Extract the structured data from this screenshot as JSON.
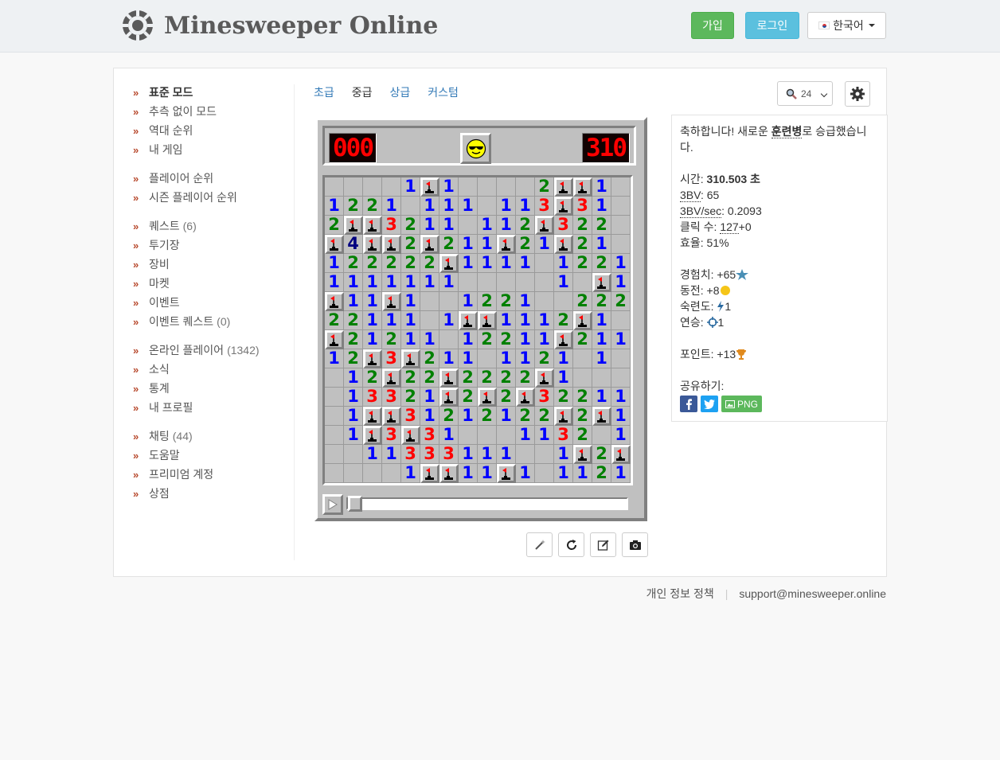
{
  "header": {
    "site_title": "Minesweeper Online",
    "join_label": "가입",
    "login_label": "로그인",
    "language_label": "한국어"
  },
  "sidebar": {
    "groups": [
      [
        {
          "label": "표준 모드",
          "active": true
        },
        {
          "label": "추측 없이 모드"
        },
        {
          "label": "역대 순위"
        },
        {
          "label": "내 게임"
        }
      ],
      [
        {
          "label": "플레이어 순위"
        },
        {
          "label": "시즌 플레이어 순위"
        }
      ],
      [
        {
          "label": "퀘스트",
          "count": "(6)"
        },
        {
          "label": "투기장"
        },
        {
          "label": "장비"
        },
        {
          "label": "마켓"
        },
        {
          "label": "이벤트"
        },
        {
          "label": "이벤트 퀘스트",
          "count": "(0)"
        }
      ],
      [
        {
          "label": "온라인 플레이어",
          "count": "(1342)"
        },
        {
          "label": "소식"
        },
        {
          "label": "통계"
        },
        {
          "label": "내 프로필"
        }
      ],
      [
        {
          "label": "채팅",
          "count": "(44)"
        },
        {
          "label": "도움말"
        },
        {
          "label": "프리미엄 계정"
        },
        {
          "label": "상점"
        }
      ]
    ]
  },
  "tabs": [
    {
      "label": "초급"
    },
    {
      "label": "중급",
      "active": true
    },
    {
      "label": "상급"
    },
    {
      "label": "커스텀"
    }
  ],
  "zoom": {
    "value": "24"
  },
  "game": {
    "mine_counter": "000",
    "timer": "310",
    "face": "sunglasses-smiley",
    "board": [
      "....1F1....2FF1.",
      "1221.111.113F31.",
      "2FF3211.112F322.",
      "F4FF2F211F21F21.",
      "122222F1111.1221",
      "1111111.....1.F1",
      "F11F1..1221..222",
      "22111.1FF1112F1.",
      "F21211.12211F211",
      "12F3F211.1121.1.",
      ".12F22F2222F1...",
      ".13321F2F2F32211",
      ".1FF31212122F2F1",
      ".1F3F31...1132.1",
      "..11333111..1F2F",
      "....1FF11F1.1121"
    ]
  },
  "result": {
    "congrats_prefix": "축하합니다! 새로운 ",
    "rank_name": "훈련병",
    "congrats_suffix": "로 승급했습니다.",
    "time_label": "시간: ",
    "time_value": "310.503 초",
    "bv_label": "3BV",
    "bv_value": ": 65",
    "bvs_label": "3BV/sec",
    "bvs_value": ": 0.2093",
    "clicks_label": "클릭 수: ",
    "clicks_value": "127",
    "clicks_extra": "+0",
    "efficiency": "효율: 51%",
    "xp": "경험치: +65",
    "coins": "동전: +8",
    "mastery": "숙련도: ",
    "mastery_value": "1",
    "streak": "연승: ",
    "streak_value": "1",
    "points": "포인트: +13",
    "share_label": "공유하기:",
    "png_label": "PNG"
  },
  "footer": {
    "privacy": "개인 정보 정책",
    "email": "support@minesweeper.online"
  },
  "colors": {
    "accent_link": "#337ab7",
    "join_green": "#5cb85c",
    "login_blue": "#5bc0de",
    "chevron": "#b84a2e"
  }
}
